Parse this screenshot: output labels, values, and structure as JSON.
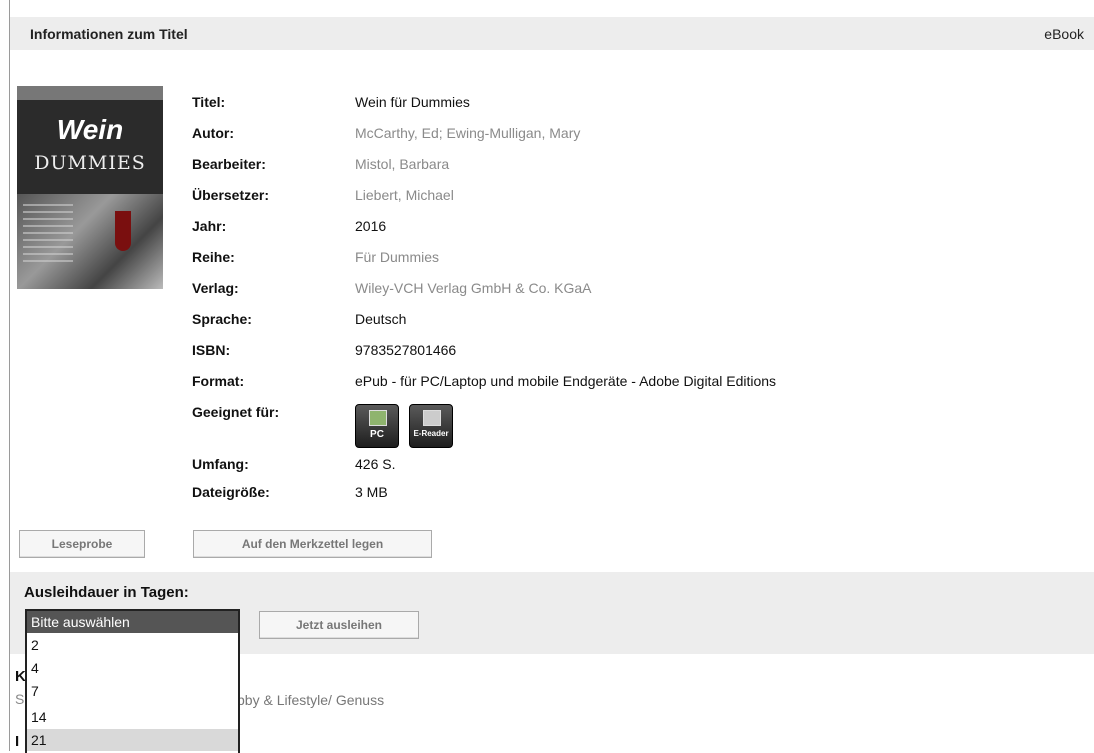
{
  "header": {
    "title": "Informationen zum Titel",
    "type": "eBook"
  },
  "cover": {
    "title": "Wein",
    "subtitle": "DUMMIES"
  },
  "details": [
    {
      "label": "Titel:",
      "value": "Wein für Dummies",
      "link": false
    },
    {
      "label": "Autor:",
      "value": "McCarthy, Ed;   Ewing-Mulligan, Mary",
      "link": true
    },
    {
      "label": "Bearbeiter:",
      "value": "Mistol, Barbara",
      "link": true
    },
    {
      "label": "Übersetzer:",
      "value": "Liebert, Michael",
      "link": true
    },
    {
      "label": "Jahr:",
      "value": "2016",
      "link": false
    },
    {
      "label": "Reihe:",
      "value": "Für Dummies",
      "link": true
    },
    {
      "label": "Verlag:",
      "value": "Wiley-VCH Verlag GmbH & Co. KGaA",
      "link": true
    },
    {
      "label": "Sprache:",
      "value": "Deutsch",
      "link": false
    },
    {
      "label": "ISBN:",
      "value": "9783527801466",
      "link": false
    },
    {
      "label": "Format:",
      "value": "ePub - für PC/Laptop und mobile Endgeräte - Adobe Digital Editions",
      "link": false
    }
  ],
  "suitable": {
    "label": "Geeignet für:",
    "devices": [
      {
        "name": "PC",
        "icon": "pc-icon"
      },
      {
        "name": "E-Reader",
        "icon": "ereader-icon"
      }
    ]
  },
  "extent": {
    "label": "Umfang:",
    "value": "426 S."
  },
  "filesize": {
    "label": "Dateigröße:",
    "value": "3 MB"
  },
  "buttons": {
    "sample": "Leseprobe",
    "wishlist": "Auf den Merkzettel legen",
    "borrow": "Jetzt ausleihen"
  },
  "loan": {
    "label": "Ausleihdauer in Tagen:",
    "selected": "Bitte auswählen",
    "options": [
      "Bitte auswählen",
      "2",
      "4",
      "7",
      "14",
      "21"
    ]
  },
  "below": {
    "k_fragment": "K",
    "s_fragment": "S",
    "i_fragment": "I",
    "category": "bby & Lifestyle/ Genuss"
  },
  "colors": {
    "header_bg": "#ededed",
    "link": "#8a8a8a",
    "selected_option": "#555555"
  }
}
